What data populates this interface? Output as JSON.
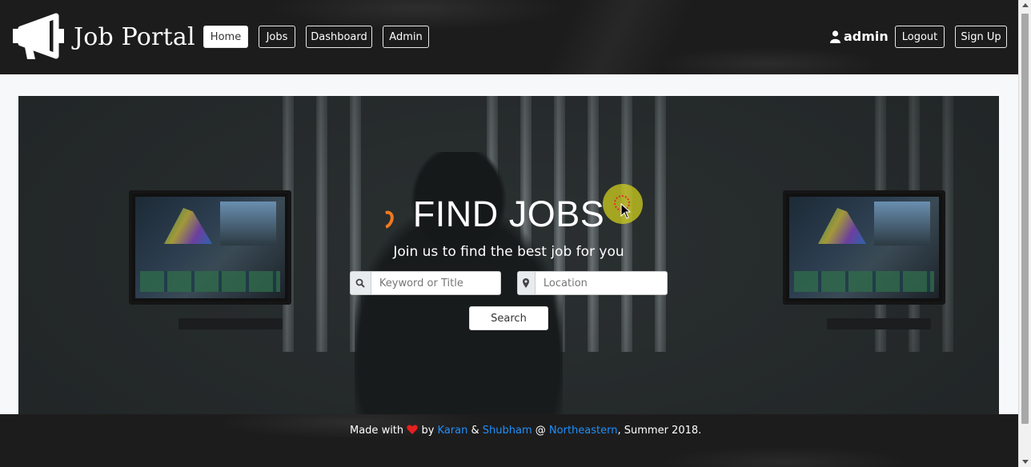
{
  "header": {
    "brand": "Job Portal",
    "nav": [
      {
        "label": "Home",
        "active": true
      },
      {
        "label": "Jobs",
        "active": false
      },
      {
        "label": "Dashboard",
        "active": false
      },
      {
        "label": "Admin",
        "active": false
      }
    ],
    "user_name": "admin",
    "logout_label": "Logout",
    "signup_label": "Sign Up",
    "logo_icon": "megaphone-icon",
    "user_icon": "user-icon"
  },
  "hero": {
    "title": "FIND JOBS",
    "subtitle": "Join us to find the best job for you",
    "keyword_placeholder": "Keyword or Title",
    "location_placeholder": "Location",
    "search_label": "Search",
    "keyword_icon": "search-icon",
    "location_icon": "map-marker-icon"
  },
  "footer": {
    "made_with": "Made with",
    "heart_icon": "heart-icon",
    "by": "by",
    "author1": "Karan",
    "amp": "&",
    "author2": "Shubham",
    "at": "@",
    "org": "Northeastern",
    "tail": ", Summer 2018."
  },
  "colors": {
    "navbar_bg": "#1d1c1c",
    "link": "#1e90ff",
    "heart": "#e8201f"
  }
}
